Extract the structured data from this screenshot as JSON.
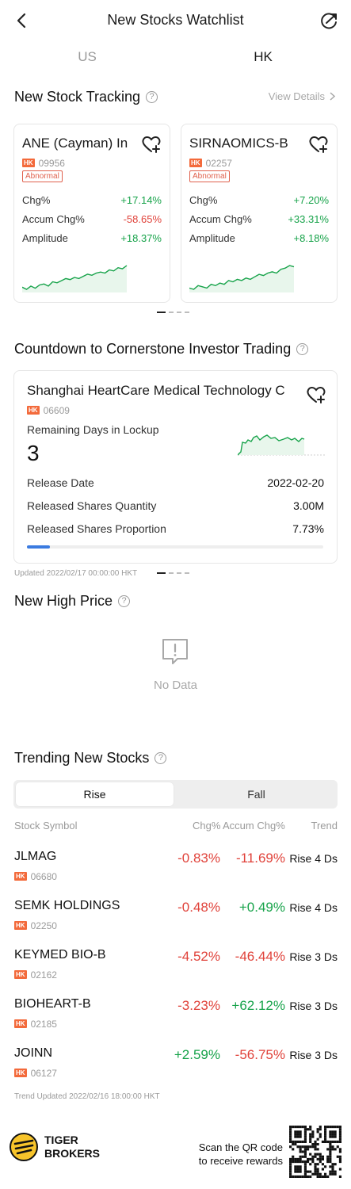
{
  "header": {
    "title": "New Stocks Watchlist"
  },
  "market_tabs": [
    "US",
    "HK"
  ],
  "new_stock_tracking": {
    "title": "New Stock Tracking",
    "view_details": "View Details",
    "cards": [
      {
        "name": "ANE (Cayman) In",
        "market": "HK",
        "code": "09956",
        "tag": "Abnormal",
        "rows": [
          {
            "label": "Chg%",
            "value": "+17.14%",
            "color": "green"
          },
          {
            "label": "Accum Chg%",
            "value": "-58.65%",
            "color": "red"
          },
          {
            "label": "Amplitude",
            "value": "+18.37%",
            "color": "green"
          }
        ],
        "spark": [
          20,
          18,
          21,
          19,
          22,
          23,
          21,
          25,
          24,
          26,
          28,
          27,
          29,
          28,
          30,
          32,
          31,
          33,
          34,
          33,
          36,
          35,
          38,
          37,
          40
        ]
      },
      {
        "name": "SIRNAOMICS-B",
        "market": "HK",
        "code": "02257",
        "tag": "Abnormal",
        "rows": [
          {
            "label": "Chg%",
            "value": "+7.20%",
            "color": "green"
          },
          {
            "label": "Accum Chg%",
            "value": "+33.31%",
            "color": "green"
          },
          {
            "label": "Amplitude",
            "value": "+8.18%",
            "color": "green"
          }
        ],
        "spark": [
          18,
          17,
          20,
          19,
          18,
          21,
          20,
          22,
          21,
          24,
          23,
          25,
          24,
          26,
          25,
          27,
          29,
          28,
          30,
          31,
          30,
          33,
          34,
          36,
          35
        ]
      }
    ]
  },
  "cornerstone": {
    "title": "Countdown to Cornerstone Investor Trading",
    "stock": {
      "name": "Shanghai HeartCare Medical Technology C",
      "market": "HK",
      "code": "06609"
    },
    "lockup_label": "Remaining Days in Lockup",
    "lockup_days": "3",
    "rows": [
      {
        "label": "Release Date",
        "value": "2022-02-20"
      },
      {
        "label": "Released Shares Quantity",
        "value": "3.00M"
      },
      {
        "label": "Released Shares  Proportion",
        "value": "7.73%"
      }
    ],
    "proportion_fill": 0.0773,
    "updated": "Updated 2022/02/17 00:00:00 HKT"
  },
  "new_high": {
    "title": "New High Price",
    "empty_text": "No Data"
  },
  "trending": {
    "title": "Trending New Stocks",
    "tabs": [
      "Rise",
      "Fall"
    ],
    "headers": {
      "symbol": "Stock Symbol",
      "chg": "Chg%",
      "accum": "Accum Chg%",
      "trend": "Trend"
    },
    "rows": [
      {
        "symbol": "JLMAG",
        "market": "HK",
        "code": "06680",
        "chg": "-0.83%",
        "chg_color": "red",
        "accum": "-11.69%",
        "accum_color": "red",
        "trend": "Rise 4 Ds"
      },
      {
        "symbol": "SEMK HOLDINGS",
        "market": "HK",
        "code": "02250",
        "chg": "-0.48%",
        "chg_color": "red",
        "accum": "+0.49%",
        "accum_color": "green",
        "trend": "Rise 4 Ds"
      },
      {
        "symbol": "KEYMED BIO-B",
        "market": "HK",
        "code": "02162",
        "chg": "-4.52%",
        "chg_color": "red",
        "accum": "-46.44%",
        "accum_color": "red",
        "trend": "Rise 3 Ds"
      },
      {
        "symbol": "BIOHEART-B",
        "market": "HK",
        "code": "02185",
        "chg": "-3.23%",
        "chg_color": "red",
        "accum": "+62.12%",
        "accum_color": "green",
        "trend": "Rise 3 Ds"
      },
      {
        "symbol": "JOINN",
        "market": "HK",
        "code": "06127",
        "chg": "+2.59%",
        "chg_color": "green",
        "accum": "-56.75%",
        "accum_color": "red",
        "trend": "Rise 3 Ds"
      }
    ],
    "updated": "Trend Updated 2022/02/16 18:00:00 HKT"
  },
  "footer": {
    "brand_line1": "TIGER",
    "brand_line2": "BROKERS",
    "qr_line1": "Scan the QR code",
    "qr_line2": "to receive rewards"
  },
  "colors": {
    "green": "#17a34a",
    "red": "#e0423a",
    "badge": "#f36a3b",
    "accent": "#3b7be0"
  },
  "icons": [
    "back-arrow-icon",
    "share-icon",
    "help-icon",
    "chevron-right-icon",
    "add-favorite-icon",
    "no-data-icon",
    "tiger-logo-icon",
    "qr-code"
  ]
}
